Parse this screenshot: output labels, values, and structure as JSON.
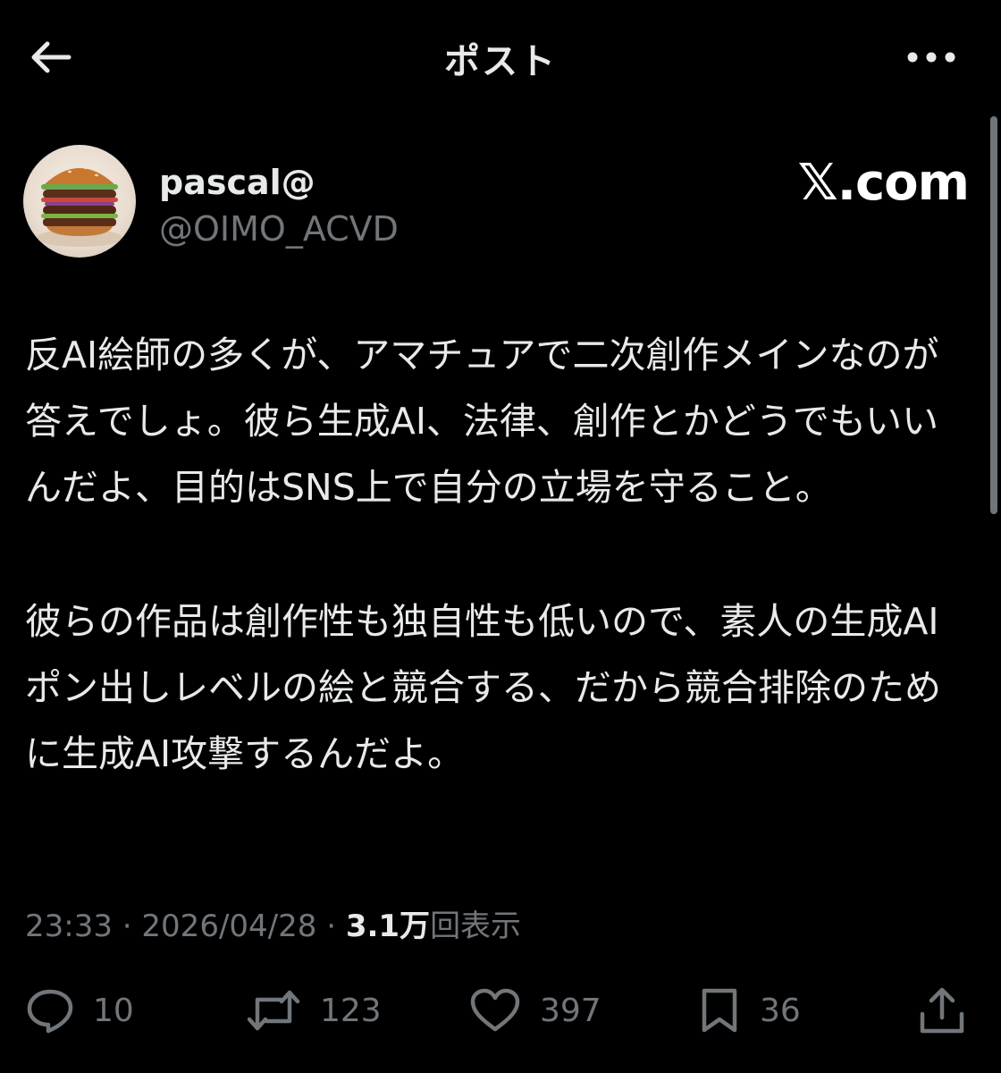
{
  "header": {
    "title": "ポスト"
  },
  "author": {
    "display_name": "pascal@",
    "handle": "@OIMO_ACVD",
    "watermark": "𝕏.com"
  },
  "post": {
    "paragraphs": [
      "反AI絵師の多くが、アマチュアで二次創作メインなのが答えでしょ。彼ら生成AI、法律、創作とかどうでもいいんだよ、目的はSNS上で自分の立場を守ること。",
      "彼らの作品は創作性も独自性も低いので、素人の生成AIポン出しレベルの絵と競合する、だから競合排除のために生成AI攻撃するんだよ。"
    ]
  },
  "meta": {
    "time": "23:33",
    "separator": "·",
    "date": "2026/04/28",
    "views_count": "3.1万",
    "views_label": "回表示"
  },
  "actions": {
    "reply_count": "10",
    "repost_count": "123",
    "like_count": "397",
    "bookmark_count": "36"
  },
  "icons": {
    "back": "arrow-left-icon",
    "more": "more-horizontal-icon",
    "reply": "speech-bubble-icon",
    "repost": "repost-arrows-icon",
    "like": "heart-icon",
    "bookmark": "bookmark-icon",
    "share": "share-upload-icon"
  },
  "colors": {
    "background": "#000000",
    "text": "#e7e9ea",
    "muted": "#71767b"
  }
}
